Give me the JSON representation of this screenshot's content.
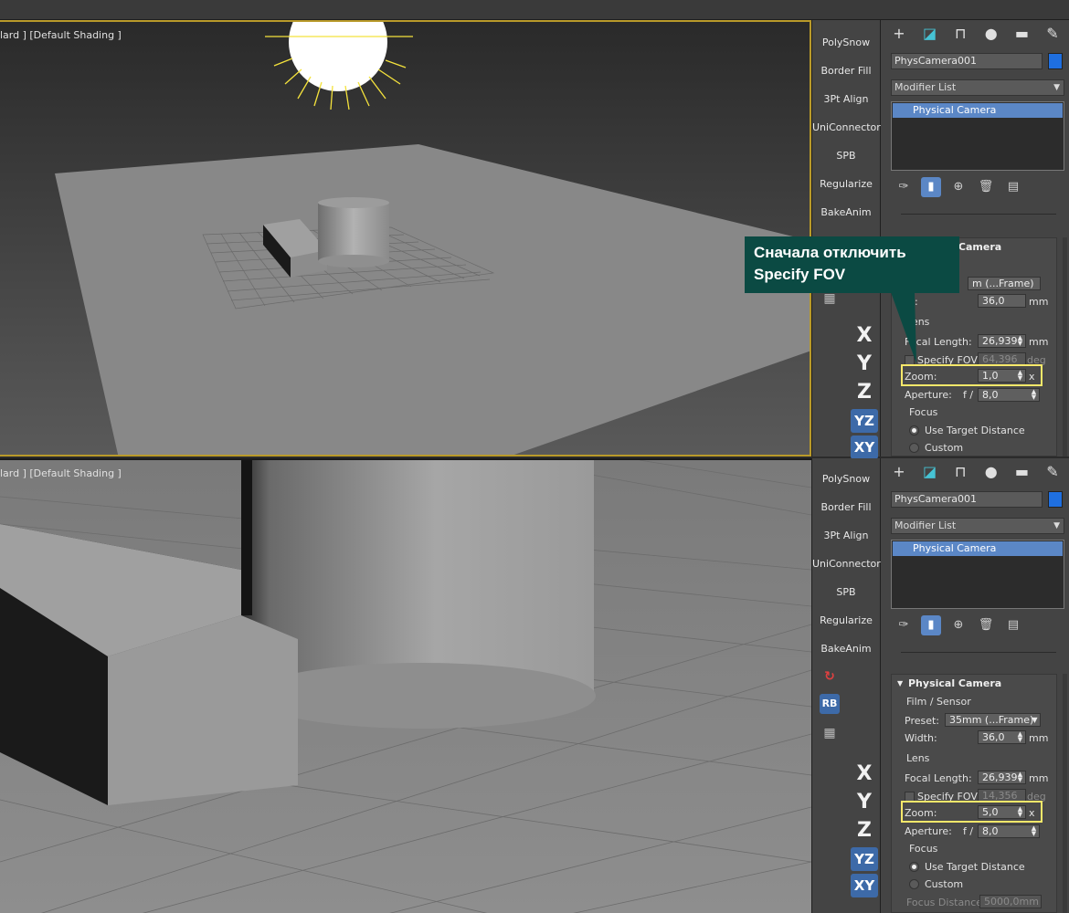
{
  "viewport_top": {
    "label": "lard ] [Default Shading ]"
  },
  "viewport_bottom": {
    "label": "lard ] [Default Shading ]"
  },
  "toolbar": {
    "buttons": [
      "PolySnow",
      "Border Fill",
      "3Pt Align",
      "UniConnector",
      "SPB",
      "Regularize",
      "BakeAnim"
    ],
    "axes": [
      "X",
      "Y",
      "Z"
    ],
    "axis_pill_yz": "YZ",
    "axis_pill_xy": "XY",
    "rb_label": "RB"
  },
  "panel_top": {
    "object_name": "PhysCamera001",
    "modifier_list": "Modifier List",
    "stack_item": "Physical Camera",
    "rollout_title": "Physical Camera",
    "preset_value": "m (...Frame)",
    "width_label": "h:",
    "width_value": "36,0",
    "width_unit": "mm",
    "lens_label": "Lens",
    "focal_label": "Focal Length:",
    "focal_value": "26,939",
    "focal_unit": "mm",
    "fov_label": "Specify FOV:",
    "fov_value": "64,396",
    "fov_unit": "deg",
    "zoom_label": "Zoom:",
    "zoom_value": "1,0",
    "zoom_unit": "x",
    "aperture_label": "Aperture:",
    "aperture_f": "f /",
    "aperture_value": "8,0",
    "focus_label": "Focus",
    "use_target": "Use Target Distance",
    "custom": "Custom"
  },
  "panel_bottom": {
    "object_name": "PhysCamera001",
    "modifier_list": "Modifier List",
    "stack_item": "Physical Camera",
    "rollout_title": "Physical Camera",
    "film_label": "Film / Sensor",
    "preset_label": "Preset:",
    "preset_value": "35mm (...Frame)",
    "width_label": "Width:",
    "width_value": "36,0",
    "width_unit": "mm",
    "lens_label": "Lens",
    "focal_label": "Focal Length:",
    "focal_value": "26,939",
    "focal_unit": "mm",
    "fov_label": "Specify FOV:",
    "fov_value": "14,356",
    "fov_unit": "deg",
    "zoom_label": "Zoom:",
    "zoom_value": "5,0",
    "zoom_unit": "x",
    "aperture_label": "Aperture:",
    "aperture_f": "f /",
    "aperture_value": "8,0",
    "focus_label": "Focus",
    "use_target": "Use Target Distance",
    "custom": "Custom",
    "focus_distance_label": "Focus Distance:",
    "focus_distance_value": "5000,0mm"
  },
  "callout": {
    "line1": "Сначала отключить",
    "line2": "Specify FOV"
  },
  "colors": {
    "accent_blue": "#5b87c6",
    "highlight_yellow": "#f7e86a",
    "callout_bg": "#0b4a43",
    "viewport_active_border": "#b99a2a"
  }
}
